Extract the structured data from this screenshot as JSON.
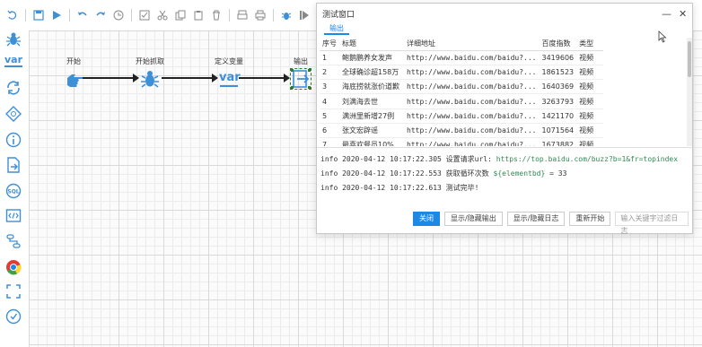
{
  "toolbar": {
    "icons": [
      "undo-icon",
      "save-icon",
      "run-icon",
      "redo-back-icon",
      "redo-icon",
      "history-icon",
      "select-icon",
      "cut-icon",
      "copy-icon",
      "delete-icon",
      "print-icon",
      "printer-icon",
      "debug-icon",
      "step-icon",
      "stop-icon",
      "panel-icon"
    ]
  },
  "sidebar": {
    "var_label": "var"
  },
  "flow": {
    "nodes": [
      {
        "label": "开始"
      },
      {
        "label": "开始抓取"
      },
      {
        "label": "定义变量"
      },
      {
        "label": "输出"
      }
    ],
    "var_text": "var"
  },
  "dialog": {
    "title": "测试窗口",
    "minimize": "—",
    "close": "✕",
    "tab": "输出",
    "headers": [
      "序号",
      "标题",
      "详细地址",
      "百度指数",
      "类型"
    ],
    "rows": [
      [
        "1",
        "鲍鹅鹏养女发声",
        "http://www.baidu.com/baidu?...",
        "3419606",
        "视频"
      ],
      [
        "2",
        "全球确诊超158万",
        "http://www.baidu.com/baidu?...",
        "1861523",
        "视频"
      ],
      [
        "3",
        "海底捞就涨价道歉",
        "http://www.baidu.com/baidu?...",
        "1640369",
        "视频"
      ],
      [
        "4",
        "刘满海去世",
        "http://www.baidu.com/baidu?...",
        "3263793",
        "视频"
      ],
      [
        "5",
        "满洲里新增27例",
        "http://www.baidu.com/baidu?...",
        "1421170",
        "视频"
      ],
      [
        "6",
        "张文宏辟谣",
        "http://www.baidu.com/baidu?...",
        "1071564",
        "视频"
      ],
      [
        "7",
        "最喜欢餐员10%",
        "http://www.baidu.com/baidu?...",
        "1673882",
        "视频"
      ],
      [
        "8",
        "",
        "",
        "",
        ""
      ]
    ],
    "log": [
      {
        "prefix": "info  2020-04-12 10:17:22.305  设置请求url: ",
        "highlight": "https://top.baidu.com/buzz?b=1&fr=topindex",
        "suffix": ""
      },
      {
        "prefix": "info  2020-04-12 10:17:22.553  获取循环次数 ",
        "highlight": "${elementbd}",
        "suffix": " = 33"
      },
      {
        "prefix": "info  2020-04-12 10:17:22.613  测试完毕!",
        "highlight": "",
        "suffix": ""
      }
    ],
    "buttons": {
      "close": "关闭",
      "toggle_output": "显示/隐藏输出",
      "toggle_log": "显示/隐藏日志",
      "restart": "重新开始",
      "filter_placeholder": "输入关键字过滤日志"
    }
  },
  "colors": {
    "accent": "#3d8fd8",
    "primary_button": "#1e88e5",
    "highlight": "#2e8b57"
  }
}
